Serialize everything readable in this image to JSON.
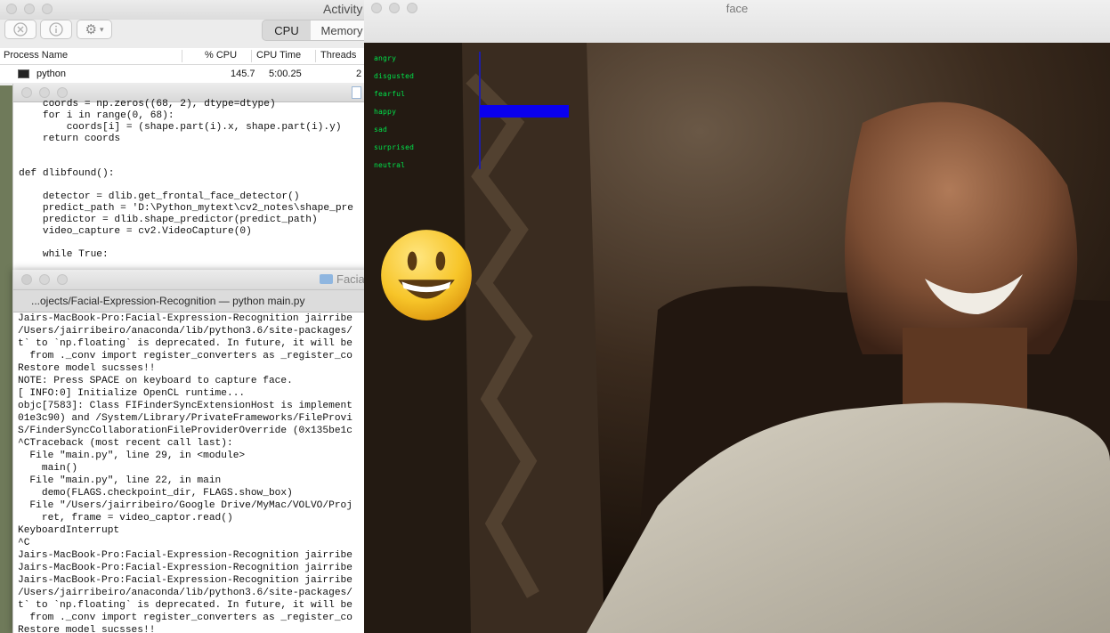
{
  "activity_monitor": {
    "title": "Activity",
    "tabs": [
      "CPU",
      "Memory"
    ],
    "active_tab": "CPU",
    "columns": [
      "Process Name",
      "% CPU",
      "CPU Time",
      "Threads"
    ],
    "process": {
      "name": "python",
      "cpu": "145.7",
      "cpu_time": "5:00.25",
      "threads": "2"
    }
  },
  "editor": {
    "code_lines": [
      "    coords = np.zeros((68, 2), dtype=dtype)",
      "    for i in range(0, 68):",
      "        coords[i] = (shape.part(i).x, shape.part(i).y)",
      "    return coords",
      "",
      "",
      "def dlibfound():",
      "",
      "    detector = dlib.get_frontal_face_detector()",
      "    predict_path = 'D:\\Python_mytext\\cv2_notes\\shape_pre",
      "    predictor = dlib.shape_predictor(predict_path)",
      "    video_capture = cv2.VideoCapture(0)",
      "",
      "    while True:"
    ]
  },
  "terminal": {
    "folder_label": "Facia",
    "tab_title": "...ojects/Facial-Expression-Recognition — python main.py",
    "lines": [
      "Jairs-MacBook-Pro:Facial-Expression-Recognition jairribe",
      "/Users/jairribeiro/anaconda/lib/python3.6/site-packages/",
      "t` to `np.floating` is deprecated. In future, it will be",
      "  from ._conv import register_converters as _register_co",
      "Restore model sucsses!!",
      "NOTE: Press SPACE on keyboard to capture face.",
      "[ INFO:0] Initialize OpenCL runtime...",
      "objc[7583]: Class FIFinderSyncExtensionHost is implement",
      "01e3c90) and /System/Library/PrivateFrameworks/FileProvi",
      "S/FinderSyncCollaborationFileProviderOverride (0x135be1c",
      "^CTraceback (most recent call last):",
      "  File \"main.py\", line 29, in <module>",
      "    main()",
      "  File \"main.py\", line 22, in main",
      "    demo(FLAGS.checkpoint_dir, FLAGS.show_box)",
      "  File \"/Users/jairribeiro/Google Drive/MyMac/VOLVO/Proj",
      "    ret, frame = video_captor.read()",
      "KeyboardInterrupt",
      "^C",
      "Jairs-MacBook-Pro:Facial-Expression-Recognition jairribe",
      "Jairs-MacBook-Pro:Facial-Expression-Recognition jairribe",
      "Jairs-MacBook-Pro:Facial-Expression-Recognition jairribe",
      "/Users/jairribeiro/anaconda/lib/python3.6/site-packages/",
      "t` to `np.floating` is deprecated. In future, it will be",
      "  from ._conv import register_converters as _register_co",
      "Restore model sucsses!!"
    ]
  },
  "face_window": {
    "title": "face",
    "emotions": [
      "angry",
      "disgusted",
      "fearful",
      "happy",
      "sad",
      "surprised",
      "neutral"
    ],
    "probabilities": [
      0.0,
      0.0,
      0.0,
      1.0,
      0.0,
      0.0,
      0.0
    ],
    "bar_color": "#0a00ee",
    "label_color": "#00e24a",
    "detected_emoji": "smiling-face"
  }
}
